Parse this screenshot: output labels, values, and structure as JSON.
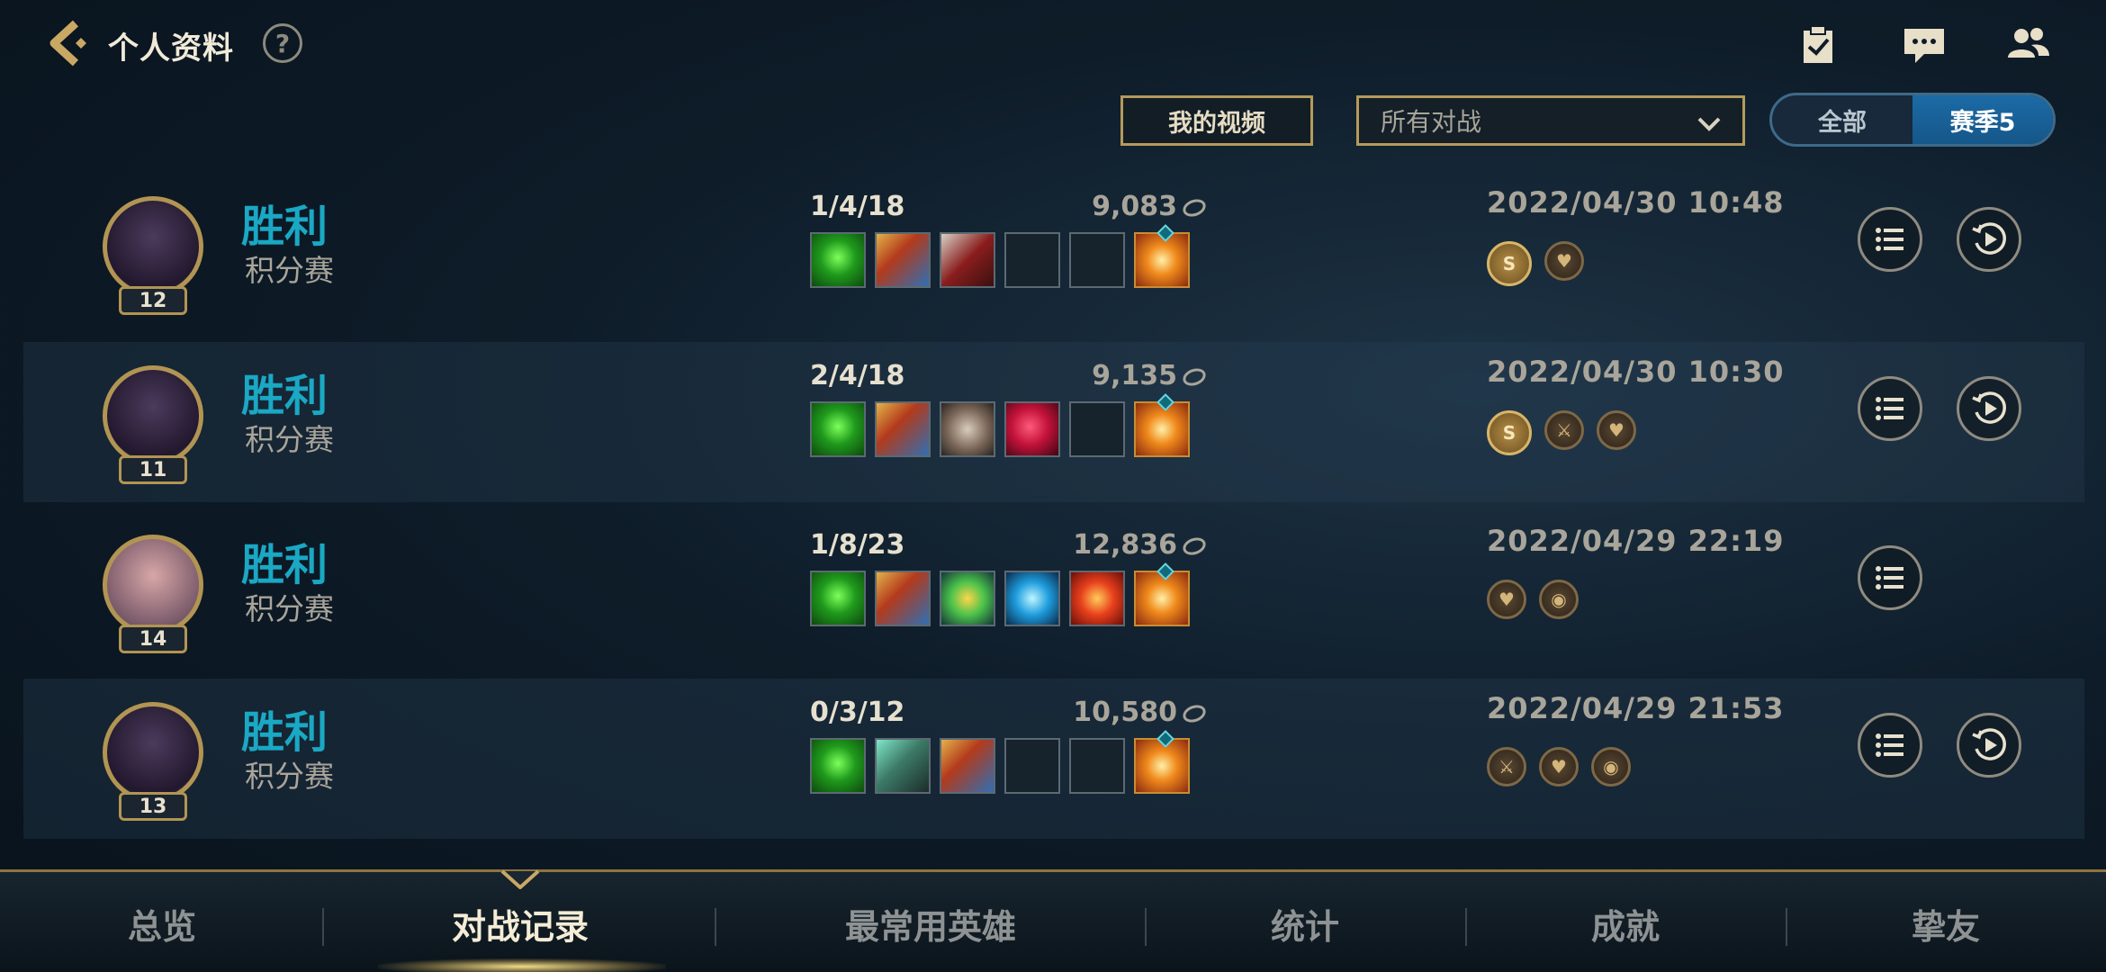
{
  "header": {
    "title": "个人资料",
    "help": "?"
  },
  "toolbar": {
    "my_videos": "我的视频",
    "filter_value": "所有对战",
    "segments": [
      "全部",
      "赛季5"
    ],
    "active_segment": 1
  },
  "matches": [
    {
      "level": "12",
      "result": "胜利",
      "mode": "积分赛",
      "kda": "1/4/18",
      "gold": "9,083",
      "datetime": "2022/04/30 10:48",
      "items": [
        "green-boots",
        "tri-shield",
        "red-cleaver",
        "",
        "",
        "orange-trinket"
      ],
      "badges": [
        "S",
        "heart"
      ],
      "has_replay": true
    },
    {
      "level": "11",
      "result": "胜利",
      "mode": "积分赛",
      "kda": "2/4/18",
      "gold": "9,135",
      "datetime": "2022/04/30 10:30",
      "items": [
        "green-boots",
        "tri-shield",
        "stone-plate",
        "ruby-crystal",
        "",
        "orange-trinket"
      ],
      "badges": [
        "S",
        "sword",
        "heart"
      ],
      "has_replay": true
    },
    {
      "level": "14",
      "result": "胜利",
      "mode": "积分赛",
      "kda": "1/8/23",
      "gold": "12,836",
      "datetime": "2022/04/29 22:19",
      "items": [
        "green-boots",
        "tri-shield",
        "green-flower",
        "blue-spirit",
        "red-orb",
        "orange-trinket"
      ],
      "badges": [
        "heart",
        "shield"
      ],
      "has_replay": false
    },
    {
      "level": "13",
      "result": "胜利",
      "mode": "积分赛",
      "kda": "0/3/12",
      "gold": "10,580",
      "datetime": "2022/04/29 21:53",
      "items": [
        "green-boots",
        "jade-armor",
        "tri-shield",
        "",
        "",
        "orange-trinket"
      ],
      "badges": [
        "sword",
        "heart",
        "shield"
      ],
      "has_replay": true
    }
  ],
  "nav": {
    "tabs": [
      "总览",
      "对战记录",
      "最常用英雄",
      "统计",
      "成就",
      "挚友"
    ],
    "active": 1
  },
  "colors": {
    "accent_gold": "#b59a5b",
    "win_text": "#1aa8c4",
    "segment_active": "#1c6aa6"
  }
}
